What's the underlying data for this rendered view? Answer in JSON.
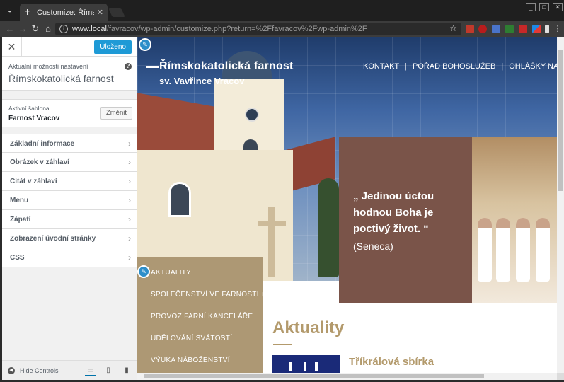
{
  "browser": {
    "tab_title": "Customize: Římskokatolická farnost",
    "url_host": "www.local",
    "url_path": "/favracov/wp-admin/customize.php?return=%2Ffavracov%2Fwp-admin%2F",
    "tab_close": "✕",
    "win_min": "_",
    "win_max": "□",
    "win_close": "✕"
  },
  "sidebar": {
    "close": "✕",
    "save_label": "Uloženo",
    "info_label": "Aktuální možnosti nastavení",
    "info_title": "Římskokatolická farnost",
    "help": "?",
    "theme_label": "Aktivní šablona",
    "theme_name": "Farnost Vracov",
    "change_label": "Změnit",
    "items": [
      {
        "label": "Základní informace"
      },
      {
        "label": "Obrázek v záhlaví"
      },
      {
        "label": "Citát v záhlaví"
      },
      {
        "label": "Menu"
      },
      {
        "label": "Zápatí"
      },
      {
        "label": "Zobrazení úvodní stránky"
      },
      {
        "label": "CSS"
      }
    ],
    "hide_label": "Hide Controls"
  },
  "preview": {
    "site_title": "Římskokatolická farnost",
    "site_subtitle": "sv. Vavřince Vracov",
    "topnav": [
      "KONTAKT",
      "POŘAD BOHOSLUŽEB",
      "OHLÁŠKY NA TÝ"
    ],
    "quote_text": "„ Jedinou úctou hodnou Boha je poctivý život. “",
    "quote_author": "(Seneca)",
    "side_menu": [
      {
        "label": "AKTUALITY"
      },
      {
        "label": "SPOLEČENSTVÍ VE FARNOSTI  ►"
      },
      {
        "label": "PROVOZ FARNÍ KANCELÁŘE"
      },
      {
        "label": "UDĚLOVÁNÍ SVÁTOSTÍ"
      },
      {
        "label": "VÝUKA NÁBOŽENSTVÍ"
      }
    ],
    "news_title": "Aktuality",
    "news_item_title": "Tříkrálová sbírka"
  },
  "colors": {
    "accent": "#1e9ad6",
    "quote_bg": "#7a5449",
    "menu_bg": "#ad9874",
    "heading_gold": "#b39a6c"
  }
}
